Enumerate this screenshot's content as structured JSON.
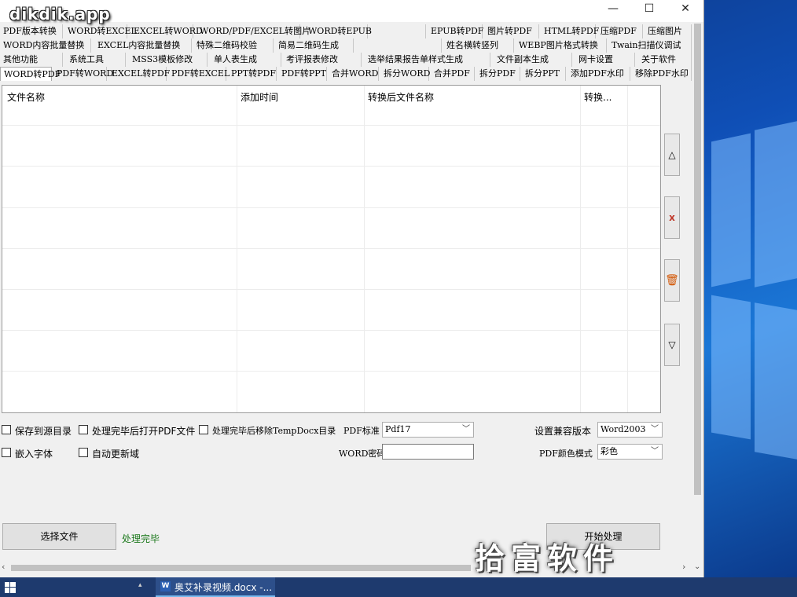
{
  "app": {
    "brand": "dikdik.app",
    "win_minimize": "—",
    "win_maximize": "☐",
    "win_close": "✕"
  },
  "tab_rows": [
    [
      "PDF版本转换",
      "WORD转EXCEL",
      "EXCEL转WORD",
      "WORD/PDF/EXCEL转图片",
      "WORD转EPUB",
      "",
      "EPUB转PDF",
      "图片转PDF",
      "HTML转PDF",
      "压缩PDF",
      "压缩图片"
    ],
    [
      "WORD内容批量替换",
      "EXCEL内容批量替换",
      "特殊二维码校验",
      "简易二维码生成",
      "",
      "姓名横转竖列",
      "WEBP图片格式转换",
      "Twain扫描仪调试"
    ],
    [
      "其他功能",
      "系统工具",
      "MSS3模板修改",
      "单人表生成",
      "考评报表修改",
      "选举结果报告单样式生成",
      "文件副本生成",
      "网卡设置",
      "关于软件"
    ],
    [
      "WORD转PDF",
      "PDF转WORD",
      "EXCEL转PDF",
      "PDF转EXCEL",
      "PPT转PDF",
      "PDF转PPT",
      "合并WORD",
      "拆分WORD",
      "合并PDF",
      "拆分PDF",
      "拆分PPT",
      "添加PDF水印",
      "移除PDF水印"
    ]
  ],
  "active_tab": "WORD转PDF",
  "file_table": {
    "columns": [
      "文件名称",
      "添加时间",
      "转换后文件名称",
      "转换..."
    ],
    "rows": []
  },
  "side_buttons": {
    "up": "△",
    "delete": "x",
    "clear": "🗑",
    "down": "▽"
  },
  "options": {
    "save_to_source": "保存到源目录",
    "open_after": "处理完毕后打开PDF文件",
    "remove_temp": "处理完毕后移除TempDocx目录",
    "embed_fonts": "嵌入字体",
    "auto_update_fields": "自动更新域",
    "pdf_standard_label": "PDF标准",
    "pdf_standard_value": "Pdf17",
    "word_password_label": "WORD密码",
    "compat_label": "设置兼容版本",
    "compat_value": "Word2003",
    "color_mode_label": "PDF颜色模式",
    "color_mode_value": "彩色"
  },
  "actions": {
    "select_files": "选择文件",
    "status": "处理完毕",
    "start": "开始处理"
  },
  "taskbar": {
    "task_label": "奥艾补录视频.docx -..."
  },
  "overlay": {
    "watermark": "拾富软件"
  },
  "colors": {
    "status_green": "#1e7a1e",
    "delete_red": "#c0392b",
    "clear_red": "#d35400"
  }
}
